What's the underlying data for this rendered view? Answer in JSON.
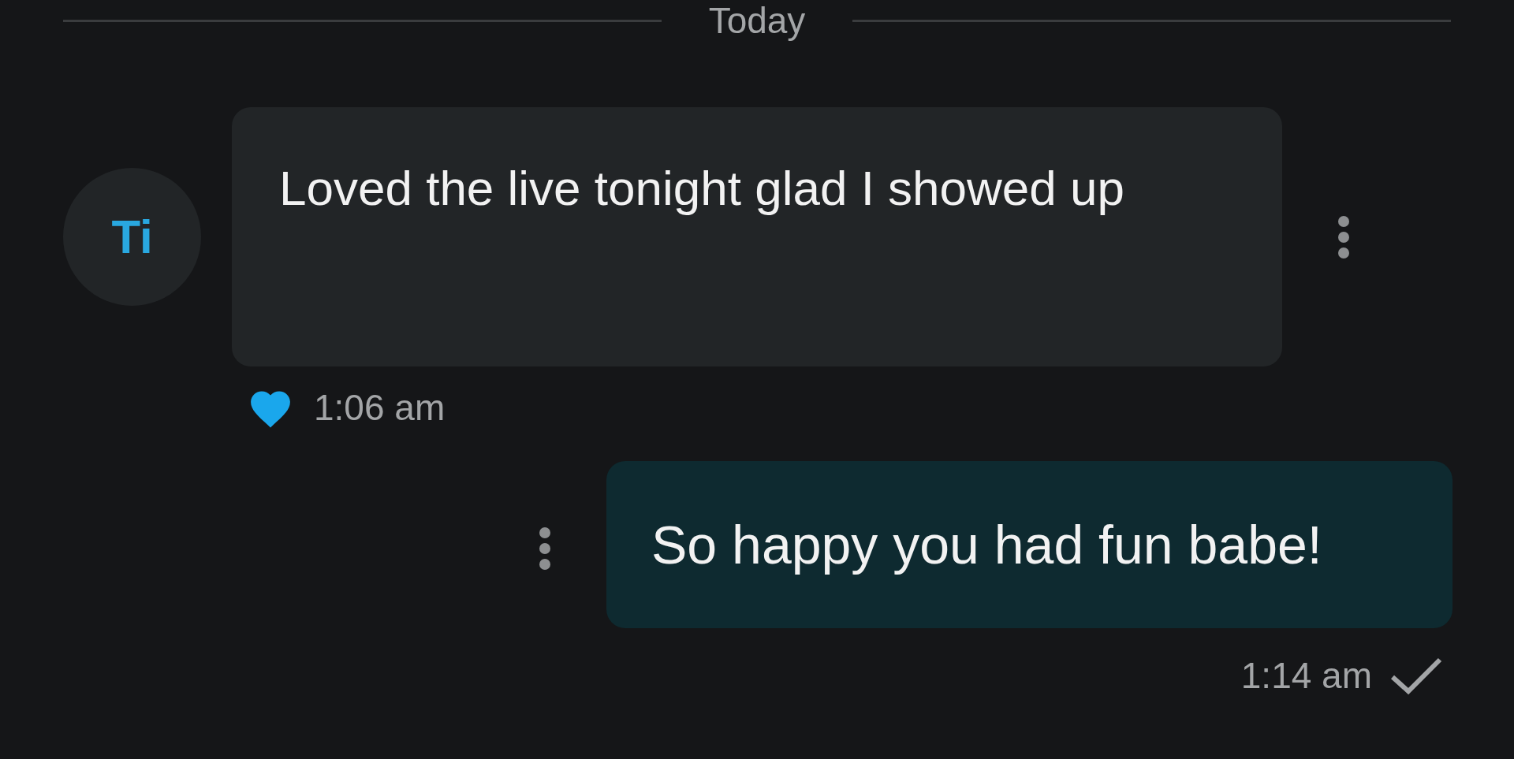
{
  "date_divider": "Today",
  "messages": [
    {
      "kind": "received",
      "avatar": "Ti",
      "text": "Loved the live tonight glad I showed up",
      "liked": true,
      "time": "1:06 am"
    },
    {
      "kind": "sent",
      "text": "So happy you had fun babe!",
      "time": "1:14 am",
      "delivered": true
    }
  ]
}
